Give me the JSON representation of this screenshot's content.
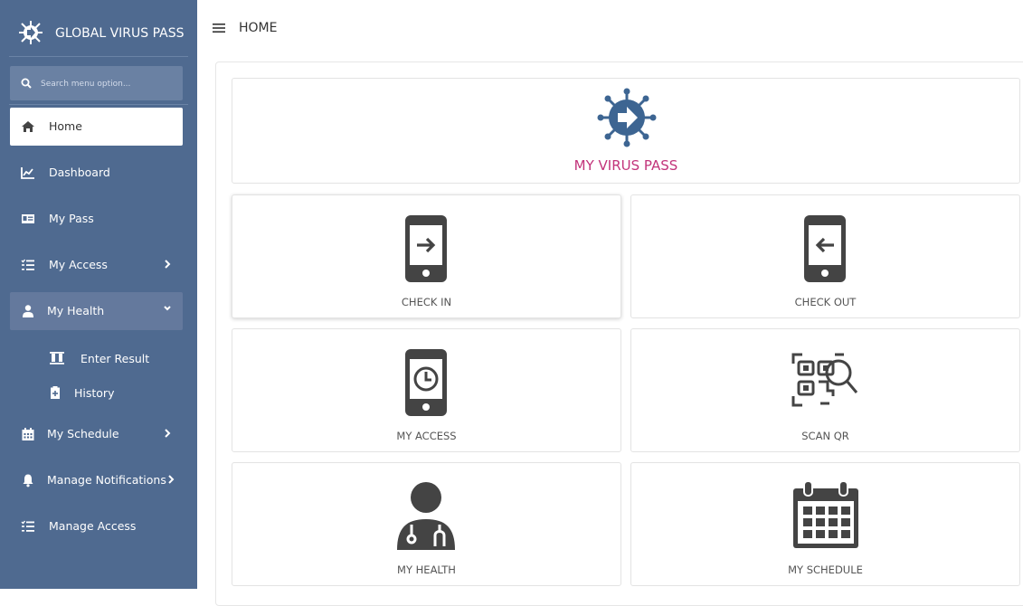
{
  "sidebar": {
    "brand": "GLOBAL VIRUS PASS",
    "search_placeholder": "Search menu option...",
    "items": [
      {
        "label": "Home",
        "icon": "home-icon"
      },
      {
        "label": "Dashboard",
        "icon": "chart-icon"
      },
      {
        "label": "My Pass",
        "icon": "id-card-icon"
      },
      {
        "label": "My Access",
        "icon": "list-icon"
      },
      {
        "label": "My Health",
        "icon": "doctor-icon"
      },
      {
        "label": "My Schedule",
        "icon": "calendar-icon"
      },
      {
        "label": "Manage Notifications",
        "icon": "bell-icon"
      },
      {
        "label": "Manage Access",
        "icon": "list-icon"
      }
    ],
    "health_sub": [
      {
        "label": "Enter Result",
        "icon": "test-tubes-icon"
      },
      {
        "label": "History",
        "icon": "clipboard-icon"
      }
    ]
  },
  "header": {
    "breadcrumb": "HOME"
  },
  "main": {
    "hero_title": "MY VIRUS PASS",
    "tiles": [
      {
        "label": "CHECK IN",
        "icon": "phone-arrow-right-icon"
      },
      {
        "label": "CHECK OUT",
        "icon": "phone-arrow-left-icon"
      },
      {
        "label": "MY ACCESS",
        "icon": "phone-clock-icon"
      },
      {
        "label": "SCAN QR",
        "icon": "qr-scan-icon"
      },
      {
        "label": "MY HEALTH",
        "icon": "doctor-icon"
      },
      {
        "label": "MY SCHEDULE",
        "icon": "calendar-icon"
      }
    ]
  },
  "colors": {
    "sidebar": "#4f6a90",
    "accent": "#c2337a",
    "virus": "#3d6592",
    "icon_dark": "#444444"
  }
}
